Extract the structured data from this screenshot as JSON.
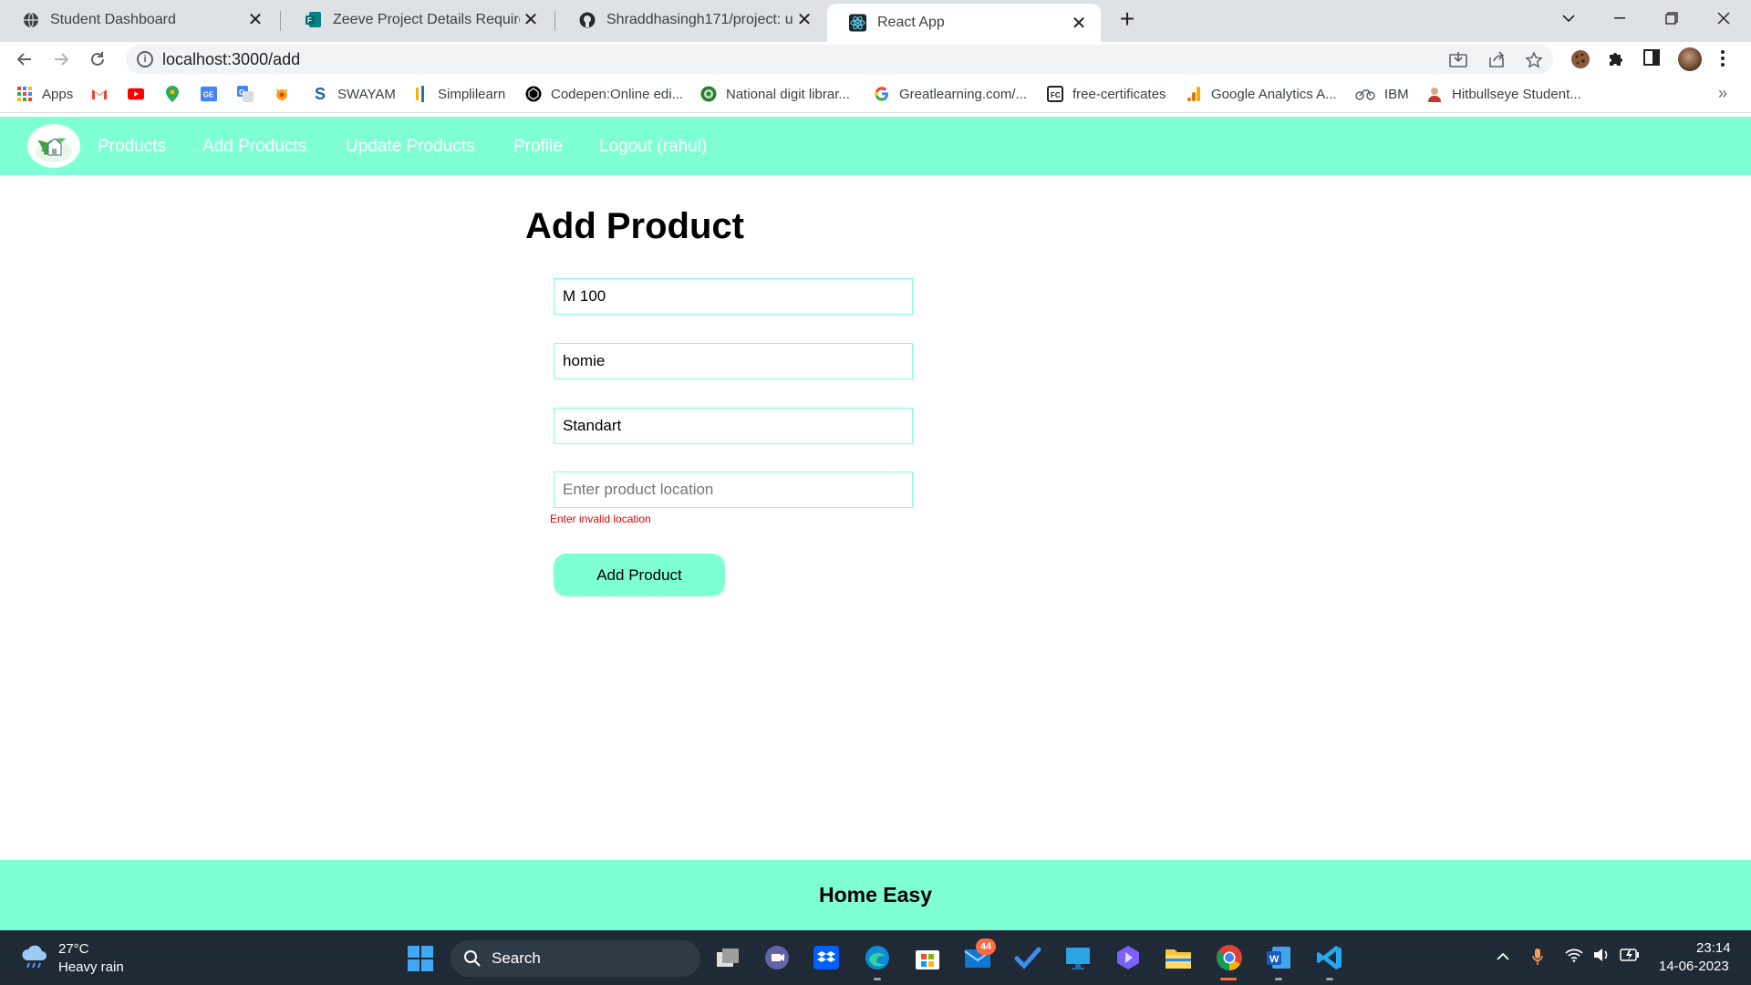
{
  "browser": {
    "tabs": [
      {
        "title": "Student Dashboard",
        "icon": "globe-icon"
      },
      {
        "title": "Zeeve Project Details Required :-",
        "icon": "forms-icon"
      },
      {
        "title": "Shraddhasingh171/project: uses",
        "icon": "github-icon"
      },
      {
        "title": "React App",
        "icon": "react-icon",
        "active": true
      }
    ],
    "new_tab_label": "+",
    "url": "localhost:3000/add",
    "bookmarks": [
      {
        "label": "Apps",
        "icon": "apps-grid-icon"
      },
      {
        "label": "",
        "icon": "gmail-icon"
      },
      {
        "label": "",
        "icon": "youtube-icon"
      },
      {
        "label": "",
        "icon": "maps-icon"
      },
      {
        "label": "",
        "icon": "google-classroom-icon"
      },
      {
        "label": "",
        "icon": "google-translate-icon"
      },
      {
        "label": "",
        "icon": "bug-icon"
      },
      {
        "label": "SWAYAM",
        "icon": "swayam-icon"
      },
      {
        "label": "Simplilearn",
        "icon": "simplilearn-icon"
      },
      {
        "label": "Codepen:Online edi...",
        "icon": "codepen-icon"
      },
      {
        "label": "National digit librar...",
        "icon": "ndl-icon"
      },
      {
        "label": "Greatlearning.com/...",
        "icon": "google-icon"
      },
      {
        "label": "free-certificates",
        "icon": "certificate-icon"
      },
      {
        "label": "Google Analytics A...",
        "icon": "analytics-icon"
      },
      {
        "label": "IBM",
        "icon": "ibm-icon"
      },
      {
        "label": "Hitbullseye Student...",
        "icon": "hitbullseye-icon"
      }
    ]
  },
  "app": {
    "nav": {
      "links": [
        "Products",
        "Add Products",
        "Update Products",
        "Profile",
        "Logout (rahul)"
      ]
    },
    "form": {
      "title": "Add Product",
      "fields": [
        {
          "name": "product-name",
          "value": "M 100",
          "placeholder": ""
        },
        {
          "name": "product-price",
          "value": "homie",
          "placeholder": ""
        },
        {
          "name": "product-category",
          "value": "Standart",
          "placeholder": ""
        },
        {
          "name": "product-location",
          "value": "",
          "placeholder": "Enter product location"
        }
      ],
      "error": "Enter invalid location",
      "submit_label": "Add Product"
    },
    "footer": {
      "text": "Home Easy"
    },
    "accent_color": "#7fffd4"
  },
  "taskbar": {
    "weather": {
      "temp": "27°C",
      "desc": "Heavy rain"
    },
    "search_label": "Search",
    "mail_badge": "44",
    "time": "23:14",
    "date": "14-06-2023"
  }
}
